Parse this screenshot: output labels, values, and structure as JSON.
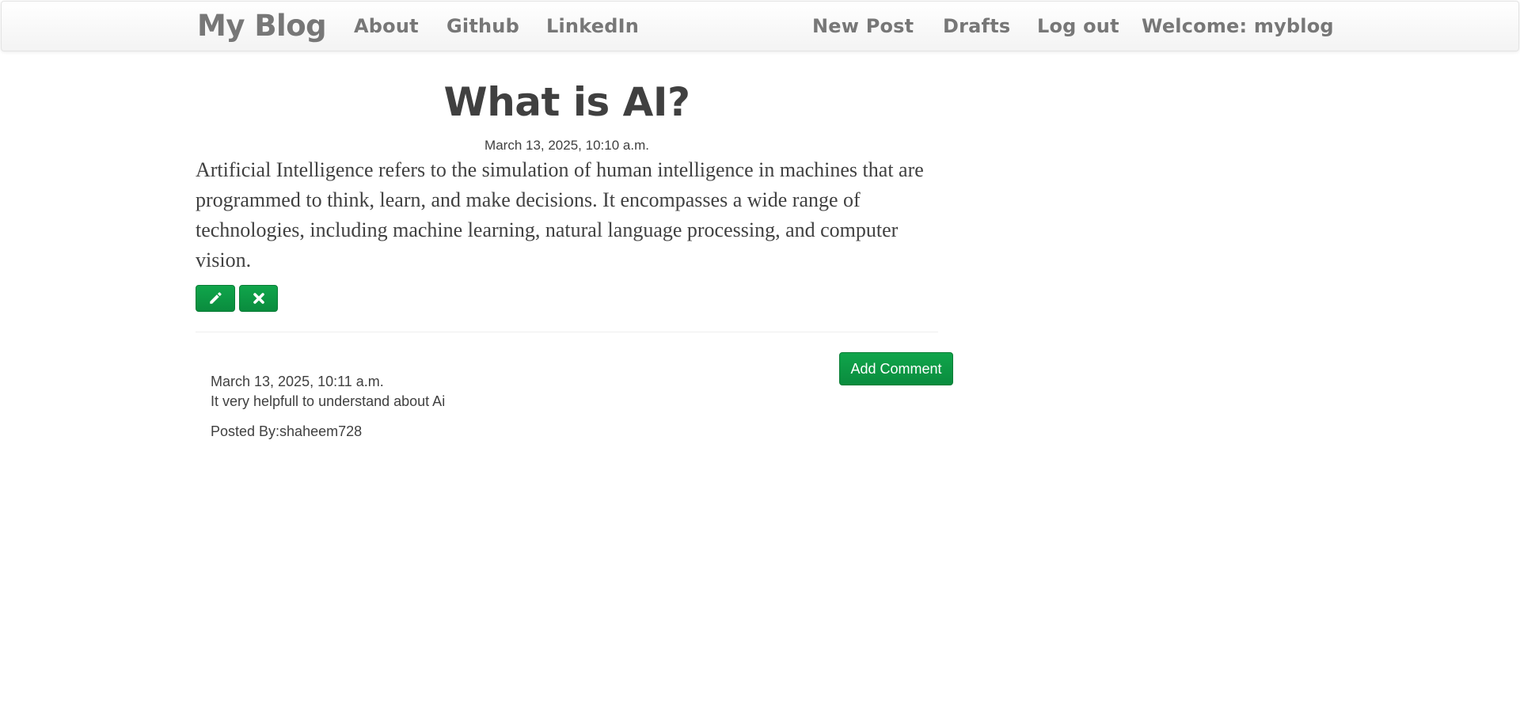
{
  "navbar": {
    "brand": "My Blog",
    "left_links": [
      "About",
      "Github",
      "LinkedIn"
    ],
    "right_links": [
      "New Post",
      "Drafts",
      "Log out"
    ],
    "welcome": "Welcome: myblog"
  },
  "post": {
    "title": "What is AI?",
    "date": "March 13, 2025, 10:10 a.m.",
    "body": "Artificial Intelligence refers to the simulation of human intelligence in machines that are programmed to think, learn, and make decisions. It encompasses a wide range of technologies, including machine learning, natural language processing, and computer vision.",
    "actions": {
      "edit_icon": "pencil-icon",
      "delete_icon": "times-icon"
    }
  },
  "comments_section": {
    "add_comment_label": "Add Comment",
    "comments": [
      {
        "date": "March 13, 2025, 10:11 a.m.",
        "text": "It very helpfull to understand about Ai",
        "author": "Posted By:shaheem728"
      }
    ]
  },
  "colors": {
    "accent": "#0a9b45",
    "nav_text": "#777777",
    "body_text": "#404040"
  }
}
